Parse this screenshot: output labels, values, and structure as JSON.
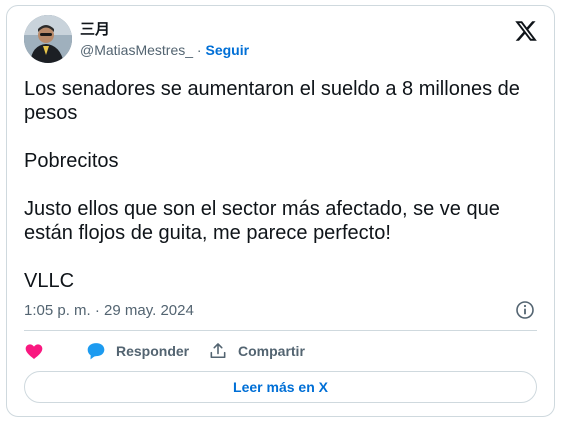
{
  "author": {
    "display_name": "三月",
    "handle": "@MatiasMestres_",
    "separator": "·",
    "follow_label": "Seguir"
  },
  "platform_icon": "x-logo-icon",
  "tweet": {
    "text": "Los senadores se aumentaron el sueldo a 8 millones de pesos\n\nPobrecitos\n\nJusto ellos que son el sector más afectado, se ve que están flojos de guita, me parece perfecto!\n\nVLLC",
    "timestamp": "1:05 p. m. · 29 may. 2024"
  },
  "actions": {
    "like_icon": "heart-icon",
    "reply_label": "Responder",
    "reply_icon": "speech-bubble-icon",
    "share_label": "Compartir",
    "share_icon": "share-upload-icon"
  },
  "footer": {
    "read_more_label": "Leer más en X"
  },
  "colors": {
    "text": "#0f1419",
    "secondary": "#536471",
    "link": "#006fd6",
    "like": "#f91880",
    "reply": "#1d9bf0",
    "border": "#cfd9de"
  }
}
